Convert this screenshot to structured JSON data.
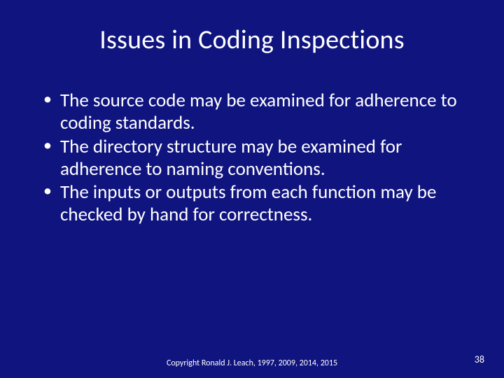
{
  "slide": {
    "title": "Issues in Coding Inspections",
    "bullets": [
      "The source code may be examined for adherence to coding standards.",
      "The directory structure may be examined for adherence to naming conventions.",
      "The inputs or outputs from each function may be checked by hand for correctness."
    ],
    "footer": "Copyright Ronald J. Leach, 1997, 2009, 2014, 2015",
    "page_number": "38"
  }
}
